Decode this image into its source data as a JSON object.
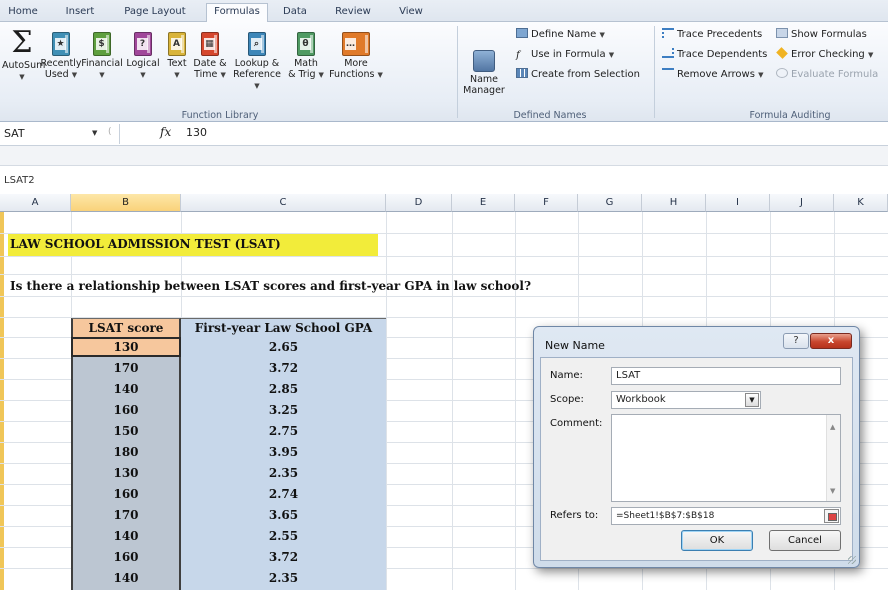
{
  "ribbon_tabs": [
    "Home",
    "Insert",
    "Page Layout",
    "Formulas",
    "Data",
    "Review",
    "View"
  ],
  "function_library": {
    "autosum": "AutoSum",
    "recently_used_1": "Recently",
    "recently_used_2": "Used",
    "financial": "Financial",
    "logical": "Logical",
    "text": "Text",
    "date_time_1": "Date &",
    "date_time_2": "Time",
    "lookup_1": "Lookup &",
    "lookup_2": "Reference",
    "math_1": "Math",
    "math_2": "& Trig",
    "more_1": "More",
    "more_2": "Functions",
    "group_label": "Function Library"
  },
  "defined_names": {
    "name_manager_1": "Name",
    "name_manager_2": "Manager",
    "define_name": "Define Name",
    "use_in_formula": "Use in Formula",
    "create_from_selection": "Create from Selection",
    "group_label": "Defined Names"
  },
  "formula_auditing": {
    "trace_precedents": "Trace Precedents",
    "trace_dependents": "Trace Dependents",
    "remove_arrows": "Remove Arrows",
    "show_formulas": "Show Formulas",
    "error_checking": "Error Checking",
    "evaluate_formula": "Evaluate Formula",
    "group_label": "Formula Auditing"
  },
  "formula_bar": {
    "name_box": "SAT",
    "fx": "fx",
    "value": "130"
  },
  "sheet_label": "LSAT2",
  "columns": [
    "A",
    "B",
    "C",
    "D",
    "E",
    "F",
    "G",
    "H",
    "I",
    "J",
    "K"
  ],
  "sheet": {
    "title": "LAW SCHOOL ADMISSION TEST (LSAT)",
    "question": "Is there a relationship between LSAT scores and first-year GPA in law school?",
    "headers": [
      "LSAT score",
      "First-year Law School GPA"
    ],
    "rows": [
      [
        "130",
        "2.65"
      ],
      [
        "170",
        "3.72"
      ],
      [
        "140",
        "2.85"
      ],
      [
        "160",
        "3.25"
      ],
      [
        "150",
        "2.75"
      ],
      [
        "180",
        "3.95"
      ],
      [
        "130",
        "2.35"
      ],
      [
        "160",
        "2.74"
      ],
      [
        "170",
        "3.65"
      ],
      [
        "140",
        "2.55"
      ],
      [
        "160",
        "3.72"
      ],
      [
        "140",
        "2.35"
      ]
    ]
  },
  "dialog": {
    "title": "New Name",
    "help": "?",
    "close": "x",
    "name_label": "Name:",
    "name_value": "LSAT",
    "scope_label": "Scope:",
    "scope_value": "Workbook",
    "comment_label": "Comment:",
    "refers_to_label": "Refers to:",
    "refers_to_value": "=Sheet1!$B$7:$B$18",
    "ok": "OK",
    "cancel": "Cancel"
  },
  "colors": {
    "title_fill": "#f2ec3a",
    "header_fill": "#f6c79d",
    "lsat_column_fill": "#bcc6d2",
    "gpa_column_fill": "#c7d7ea",
    "close_button": "#c8462e"
  }
}
